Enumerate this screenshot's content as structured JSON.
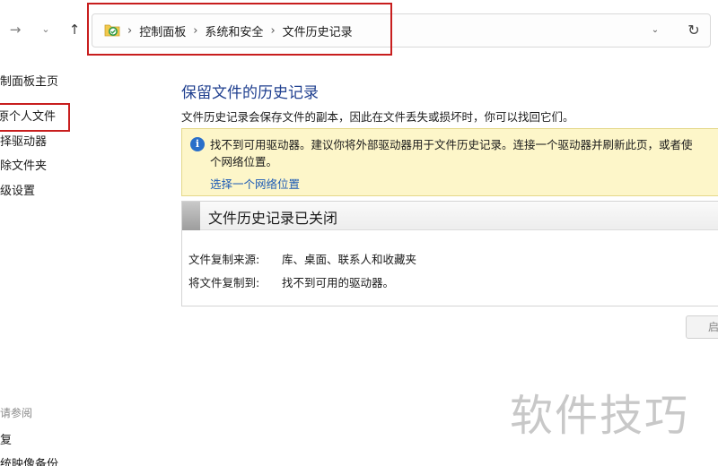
{
  "nav": {
    "forward_glyph": "→",
    "recent_glyph": "⌄",
    "up_glyph": "↑",
    "dropdown_glyph": "⌄",
    "refresh_glyph": "↻"
  },
  "breadcrumb": {
    "separator": "›",
    "items": [
      "控制面板",
      "系统和安全",
      "文件历史记录"
    ]
  },
  "sidebar": {
    "items": [
      "制面板主页",
      "原个人文件",
      "择驱动器",
      "除文件夹",
      "级设置"
    ],
    "see_also_heading": "请参阅",
    "see_also_items": [
      "复",
      "统映像备份"
    ]
  },
  "main": {
    "title": "保留文件的历史记录",
    "description": "文件历史记录会保存文件的副本，因此在文件丢失或损坏时，你可以找回它们。",
    "info": {
      "line1": "找不到可用驱动器。建议你将外部驱动器用于文件历史记录。连接一个驱动器并刷新此页，或者使",
      "line2": "个网络位置。",
      "link": "选择一个网络位置"
    },
    "status": {
      "title": "文件历史记录已关闭",
      "rows": [
        {
          "label": "文件复制来源:",
          "value": "库、桌面、联系人和收藏夹"
        },
        {
          "label": "将文件复制到:",
          "value": "找不到可用的驱动器。"
        }
      ]
    },
    "partial_button": "启"
  },
  "watermark": "软件技巧",
  "colors": {
    "title_blue": "#1f3f8f",
    "link_blue": "#1d5bb5",
    "info_bg": "#fdf6c9",
    "highlight_red": "#c81e1e"
  },
  "icons": {
    "folder": "control-panel-folder-icon",
    "info": "info-icon"
  }
}
